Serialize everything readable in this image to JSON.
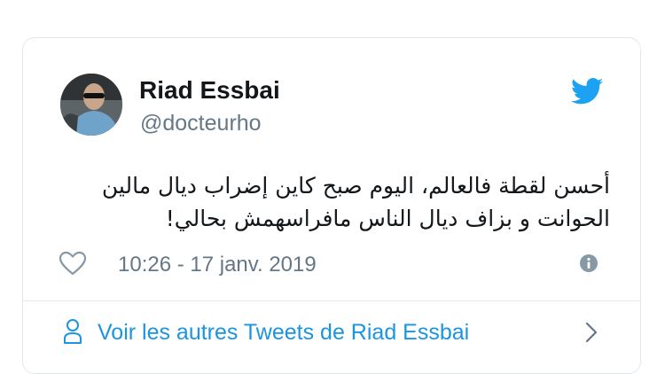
{
  "author": {
    "name": "Riad Essbai",
    "handle": "@docteurho"
  },
  "tweet": {
    "lines": [
      "أحسن لقطة فالعالم،  اليوم صبح كاين إضراب ديال مالين",
      "الحوانت و بزاف ديال الناس مافراسهمش بحالي!"
    ],
    "timestamp": "10:26 - 17 janv. 2019"
  },
  "footer": {
    "more_tweets_label": "Voir les autres Tweets de Riad Essbai"
  },
  "icons": {
    "bird": "twitter-bird-icon",
    "like": "heart-icon",
    "info": "info-icon",
    "profile": "person-icon",
    "chevron": "chevron-right-icon"
  },
  "colors": {
    "brand_blue": "#1da1f2",
    "link_blue": "#1b95e0",
    "text": "#14171a",
    "secondary_text": "#657786",
    "border": "#e1e8ed"
  }
}
